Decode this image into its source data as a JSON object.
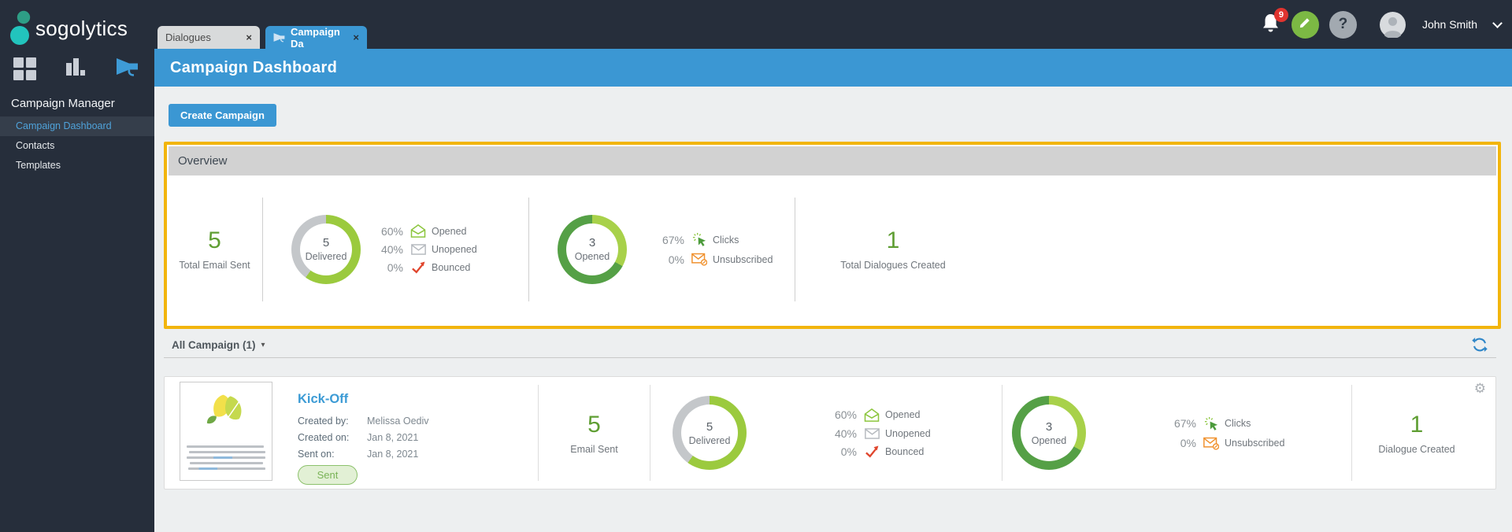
{
  "brand": {
    "logo_text": "sogolytics"
  },
  "icons": {
    "close": "×",
    "caret_down": "▾",
    "gear": "⚙",
    "question": "?"
  },
  "topbar": {
    "tabs": [
      {
        "label": "Dialogues",
        "active": false
      },
      {
        "label": "Campaign Da",
        "active": true
      }
    ],
    "notification_count": "9",
    "user_name": "John Smith"
  },
  "sidebar": {
    "section_label": "Campaign Manager",
    "items": [
      {
        "label": "Campaign Dashboard",
        "active": true
      },
      {
        "label": "Contacts",
        "active": false
      },
      {
        "label": "Templates",
        "active": false
      }
    ]
  },
  "header": {
    "title": "Campaign Dashboard"
  },
  "actions": {
    "create_campaign_label": "Create Campaign"
  },
  "overview": {
    "title": "Overview",
    "total_email_sent": {
      "value": "5",
      "label": "Total Email Sent"
    },
    "delivered": {
      "value": "5",
      "label": "Delivered",
      "ring": [
        {
          "pct": 60,
          "color": "#9BCA3E"
        },
        {
          "pct": 40,
          "color": "#C4C7CA"
        }
      ],
      "legend": [
        {
          "pct": "60%",
          "label": "Opened"
        },
        {
          "pct": "40%",
          "label": "Unopened"
        },
        {
          "pct": "0%",
          "label": "Bounced"
        }
      ]
    },
    "opened": {
      "value": "3",
      "label": "Opened",
      "ring": [
        {
          "pct": 33,
          "color": "#A8D14A"
        },
        {
          "pct": 67,
          "color": "#55A046"
        }
      ],
      "legend": [
        {
          "pct": "67%",
          "label": "Clicks"
        },
        {
          "pct": "0%",
          "label": "Unsubscribed"
        }
      ]
    },
    "dialogues": {
      "value": "1",
      "label": "Total Dialogues Created"
    }
  },
  "campaign_filter": {
    "label": "All Campaign (1)"
  },
  "campaign": {
    "title": "Kick-Off",
    "fields": [
      {
        "label": "Created by:",
        "value": "Melissa Oediv"
      },
      {
        "label": "Created on:",
        "value": "Jan 8, 2021"
      },
      {
        "label": "Sent on:",
        "value": "Jan 8, 2021"
      }
    ],
    "status": "Sent",
    "email_sent": {
      "value": "5",
      "label": "Email Sent"
    },
    "delivered": {
      "value": "5",
      "label": "Delivered",
      "ring": [
        {
          "pct": 60,
          "color": "#9BCA3E"
        },
        {
          "pct": 40,
          "color": "#C4C7CA"
        }
      ],
      "legend": [
        {
          "pct": "60%",
          "label": "Opened"
        },
        {
          "pct": "40%",
          "label": "Unopened"
        },
        {
          "pct": "0%",
          "label": "Bounced"
        }
      ]
    },
    "opened": {
      "value": "3",
      "label": "Opened",
      "ring": [
        {
          "pct": 33,
          "color": "#A8D14A"
        },
        {
          "pct": 67,
          "color": "#55A046"
        }
      ],
      "legend": [
        {
          "pct": "67%",
          "label": "Clicks"
        },
        {
          "pct": "0%",
          "label": "Unsubscribed"
        }
      ]
    },
    "dialogue": {
      "value": "1",
      "label": "Dialogue Created"
    }
  },
  "colors": {
    "accent_blue": "#3B97D3",
    "highlight_yellow": "#F2B50D",
    "green_number": "#5F9E33",
    "ring_light_green": "#9BCA3E",
    "ring_dark_green": "#55A046",
    "ring_gray": "#C4C7CA",
    "bounced_red": "#E0462E",
    "unsubscribed_orange": "#F0912D"
  }
}
